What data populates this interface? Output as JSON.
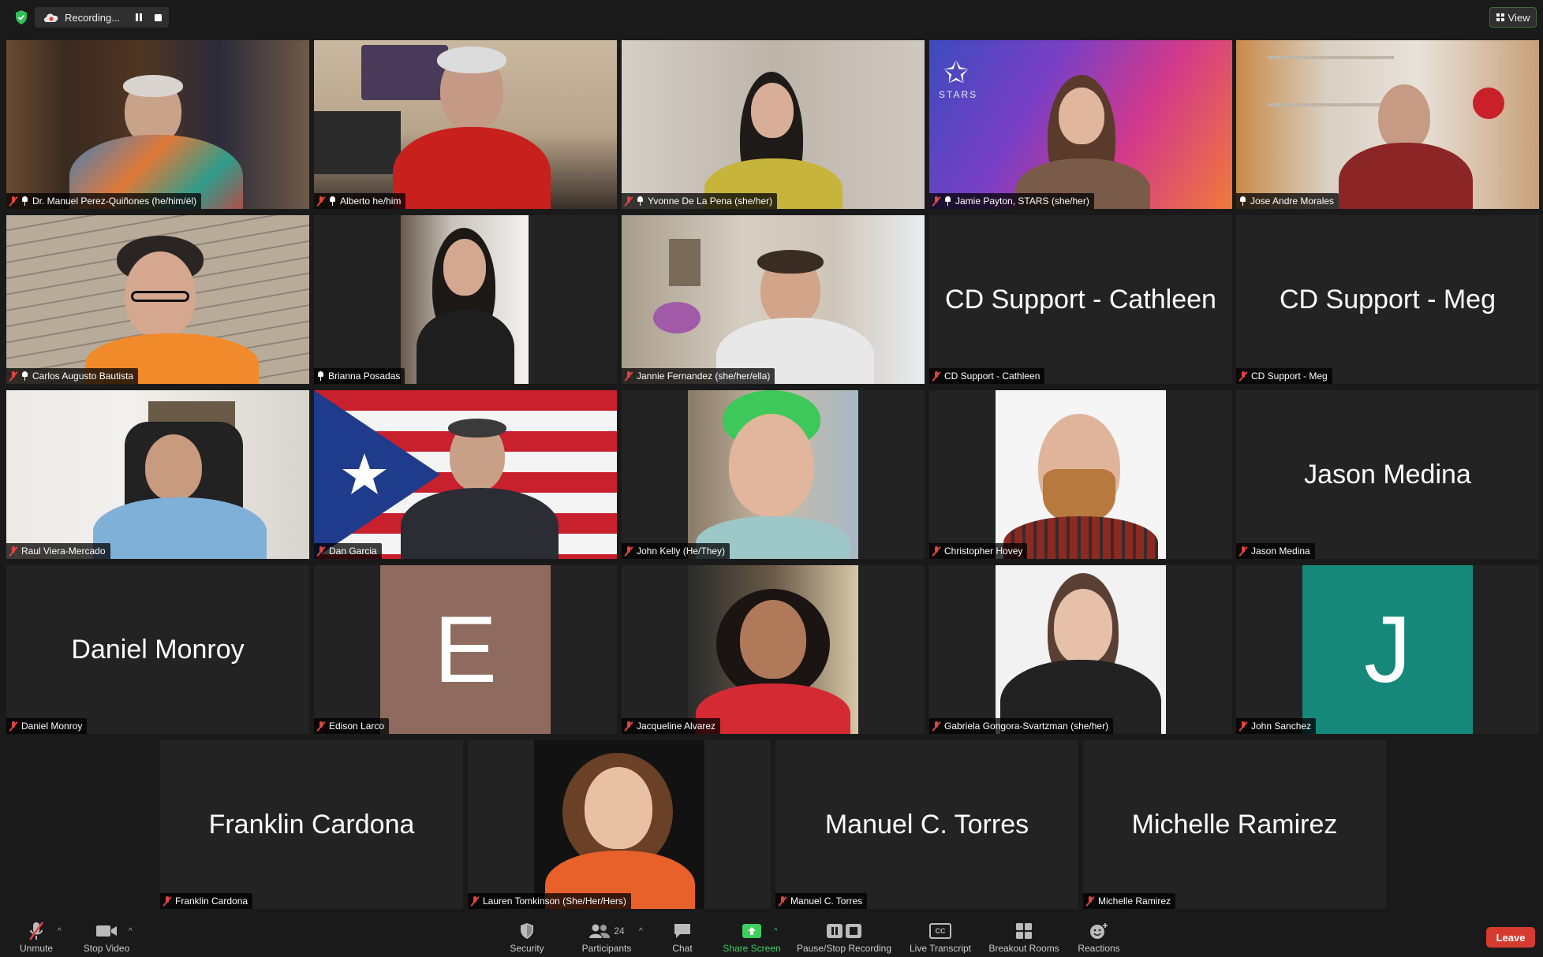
{
  "topbar": {
    "recording_label": "Recording...",
    "view_label": "View"
  },
  "tiles": [
    {
      "label": "Dr. Manuel Perez-Quiñones (he/him/él)"
    },
    {
      "label": "Alberto he/him"
    },
    {
      "label": "Yvonne De La Pena (she/her)"
    },
    {
      "label": "Jamie Payton, STARS (she/her)",
      "background_text": "STARS"
    },
    {
      "label": "Jose Andre Morales"
    },
    {
      "label": "Carlos Augusto Bautista"
    },
    {
      "label": "Brianna Posadas"
    },
    {
      "label": "Jannie Fernandez (she/her/ella)"
    },
    {
      "label": "CD Support - Cathleen",
      "big_name": "CD Support - Cathleen"
    },
    {
      "label": "CD Support - Meg",
      "big_name": "CD Support - Meg"
    },
    {
      "label": "Raul Viera-Mercado"
    },
    {
      "label": "Dan Garcia"
    },
    {
      "label": "John Kelly  (He/They)"
    },
    {
      "label": "Christopher Hovey"
    },
    {
      "label": "Jason Medina",
      "big_name": "Jason Medina"
    },
    {
      "label": "Daniel Monroy",
      "big_name": "Daniel Monroy"
    },
    {
      "label": "Edison Larco",
      "avatar_letter": "E"
    },
    {
      "label": "Jacqueline Alvarez"
    },
    {
      "label": "Gabriela Gongora-Svartzman  (she/her)"
    },
    {
      "label": "John Sanchez",
      "avatar_letter": "J"
    },
    {
      "label": "Franklin Cardona",
      "big_name": "Franklin Cardona"
    },
    {
      "label": "Lauren Tomkinson  (She/Her/Hers)"
    },
    {
      "label": "Manuel C. Torres",
      "big_name": "Manuel C. Torres"
    },
    {
      "label": "Michelle Ramirez",
      "big_name": "Michelle Ramirez"
    }
  ],
  "toolbar": {
    "unmute": "Unmute",
    "stop_video": "Stop Video",
    "security": "Security",
    "participants": "Participants",
    "participants_count": "24",
    "chat": "Chat",
    "share_screen": "Share Screen",
    "pause_stop_recording": "Pause/Stop Recording",
    "live_transcript": "Live Transcript",
    "cc": "CC",
    "breakout_rooms": "Breakout Rooms",
    "reactions": "Reactions",
    "leave": "Leave"
  },
  "colors": {
    "active_speaker_border": "#e6e67a",
    "leave_button": "#d63b30",
    "share_screen_green": "#3ecf5e",
    "muted_red": "#e0443e",
    "avatar_e": "#8e6b5e",
    "avatar_j": "#15887a"
  }
}
